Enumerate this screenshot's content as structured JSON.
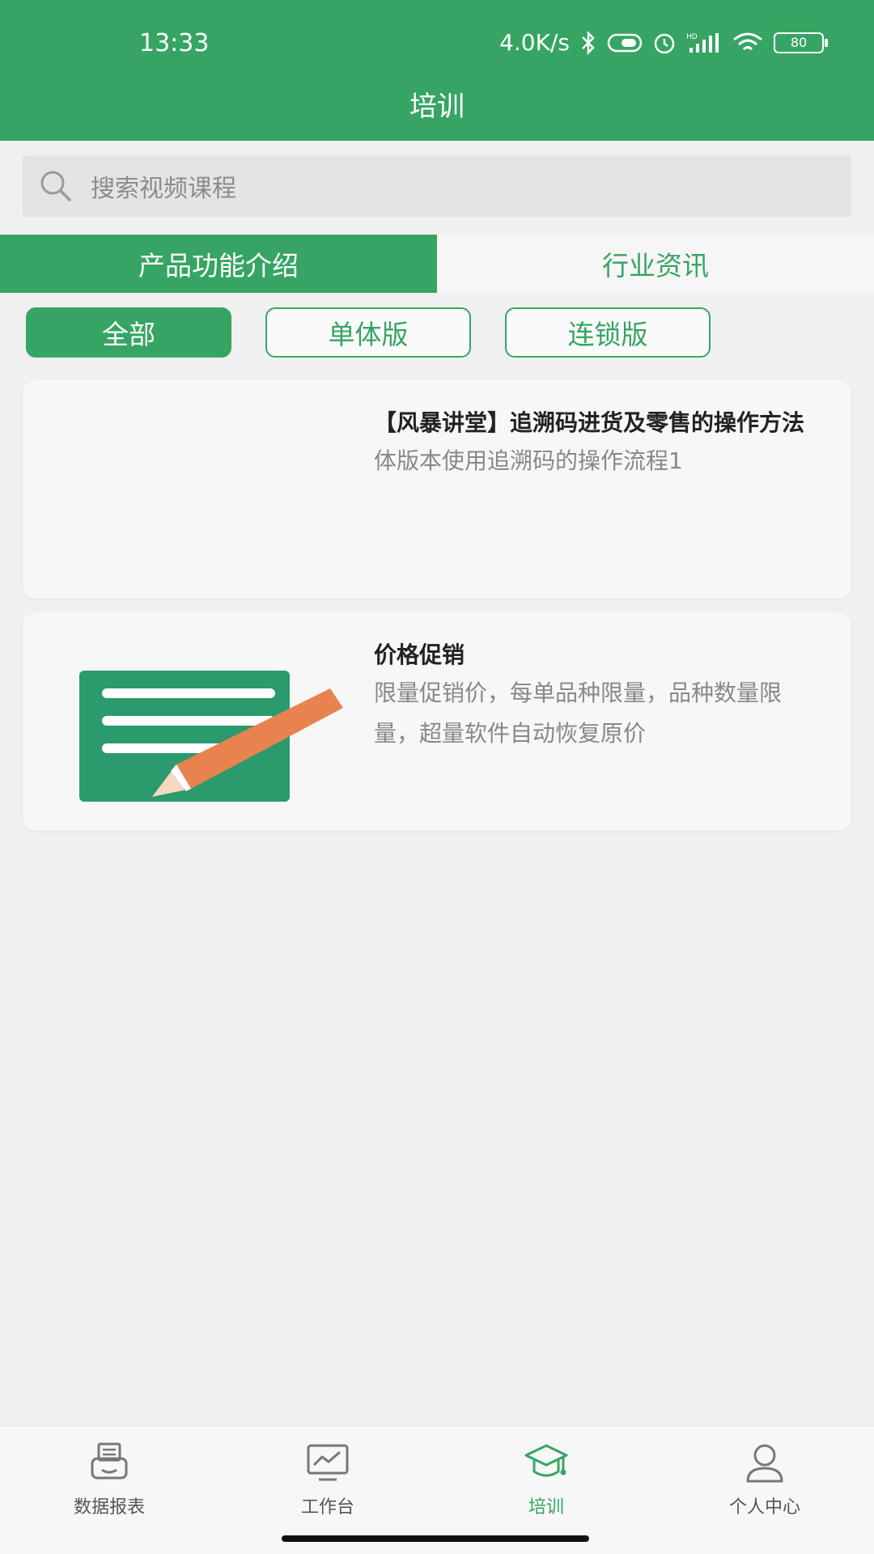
{
  "status_bar": {
    "time": "13:33",
    "network_speed": "4.0K/s",
    "battery": "80",
    "icons": [
      "bluetooth-icon",
      "nfc-icon",
      "alarm-icon",
      "hd-signal-icon",
      "wifi-icon",
      "battery-icon"
    ]
  },
  "header": {
    "title": "培训"
  },
  "search": {
    "placeholder": "搜索视频课程"
  },
  "tabs": [
    {
      "label": "产品功能介绍",
      "active": true
    },
    {
      "label": "行业资讯",
      "active": false
    }
  ],
  "filters": [
    {
      "label": "全部",
      "active": true
    },
    {
      "label": "单体版",
      "active": false
    },
    {
      "label": "连锁版",
      "active": false
    }
  ],
  "courses": [
    {
      "title": "【风暴讲堂】追溯码进货及零售的操作方法",
      "description": "体版本使用追溯码的操作流程1",
      "thumbnail": "blank"
    },
    {
      "title": "价格促销",
      "description": "限量促销价，每单品种限量，品种数量限量，超量软件自动恢复原价",
      "thumbnail": "document-edit-icon"
    }
  ],
  "bottom_nav": [
    {
      "label": "数据报表",
      "icon": "printer-report-icon",
      "active": false
    },
    {
      "label": "工作台",
      "icon": "monitor-chart-icon",
      "active": false
    },
    {
      "label": "培训",
      "icon": "graduation-cap-icon",
      "active": true
    },
    {
      "label": "个人中心",
      "icon": "user-icon",
      "active": false
    }
  ],
  "colors": {
    "primary": "#36a563",
    "accent_orange": "#e8834f",
    "background": "#f0f0f0"
  }
}
